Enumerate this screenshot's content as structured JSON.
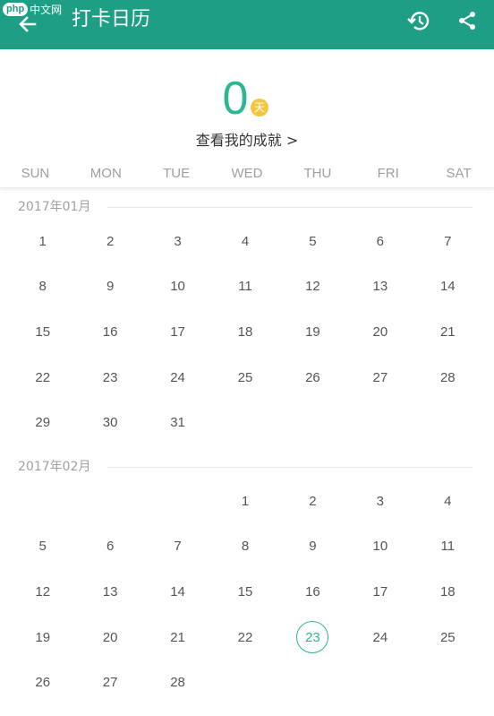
{
  "watermark": {
    "badge": "php",
    "text": "中文网"
  },
  "appbar": {
    "title": "打卡日历",
    "back_icon": "arrow-left-icon",
    "history_icon": "history-icon",
    "share_icon": "share-icon"
  },
  "streak": {
    "count": "0",
    "unit": "天",
    "achievements_link": "查看我的成就 >"
  },
  "weekdays": [
    "SUN",
    "MON",
    "TUE",
    "WED",
    "THU",
    "FRI",
    "SAT"
  ],
  "colors": {
    "primary": "#1f9e86",
    "accent": "#2bb890",
    "badge": "#f3c63f"
  },
  "months": [
    {
      "title": "2017年01月",
      "leading_blanks": 0,
      "days": [
        "1",
        "2",
        "3",
        "4",
        "5",
        "6",
        "7",
        "8",
        "9",
        "10",
        "11",
        "12",
        "13",
        "14",
        "15",
        "16",
        "17",
        "18",
        "19",
        "20",
        "21",
        "22",
        "23",
        "24",
        "25",
        "26",
        "27",
        "28",
        "29",
        "30",
        "31"
      ]
    },
    {
      "title": "2017年02月",
      "leading_blanks": 3,
      "today": "23",
      "days": [
        "1",
        "2",
        "3",
        "4",
        "5",
        "6",
        "7",
        "8",
        "9",
        "10",
        "11",
        "12",
        "13",
        "14",
        "15",
        "16",
        "17",
        "18",
        "19",
        "20",
        "21",
        "22",
        "23",
        "24",
        "25",
        "26",
        "27",
        "28"
      ]
    }
  ]
}
